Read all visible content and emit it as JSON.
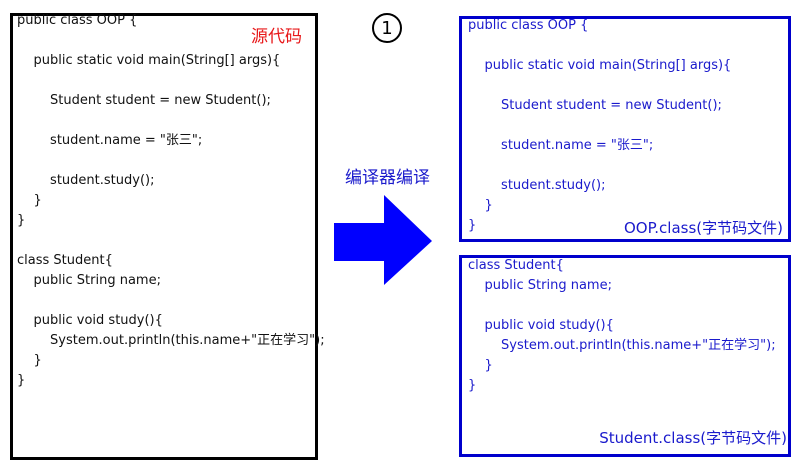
{
  "step_number": "1",
  "compile_label": "编译器编译",
  "source": {
    "label": "源代码",
    "lines": [
      "public class OOP {",
      "    public static void main(String[] args){",
      "        Student student = new Student();",
      "        student.name = \"张三\";",
      "        student.study();",
      "    }",
      "}",
      "class Student{",
      "    public String name;",
      "    public void study(){",
      "        System.out.println(this.name+\"正在学习\");",
      "    }",
      "}"
    ]
  },
  "oop_class": {
    "label": "OOP.class(字节码文件)",
    "lines": [
      "public class OOP {",
      "    public static void main(String[] args){",
      "        Student student = new Student();",
      "        student.name = \"张三\";",
      "        student.study();",
      "    }",
      "}"
    ]
  },
  "student_class": {
    "label": "Student.class(字节码文件)",
    "lines": [
      "class Student{",
      "    public String name;",
      "    public void study(){",
      "        System.out.println(this.name+\"正在学习\");",
      "    }",
      "}"
    ]
  },
  "colors": {
    "source_border": "#000000",
    "class_border": "#0000cc",
    "class_text": "#1a1acc",
    "source_label": "#e8181a",
    "arrow": "#0000ff"
  }
}
